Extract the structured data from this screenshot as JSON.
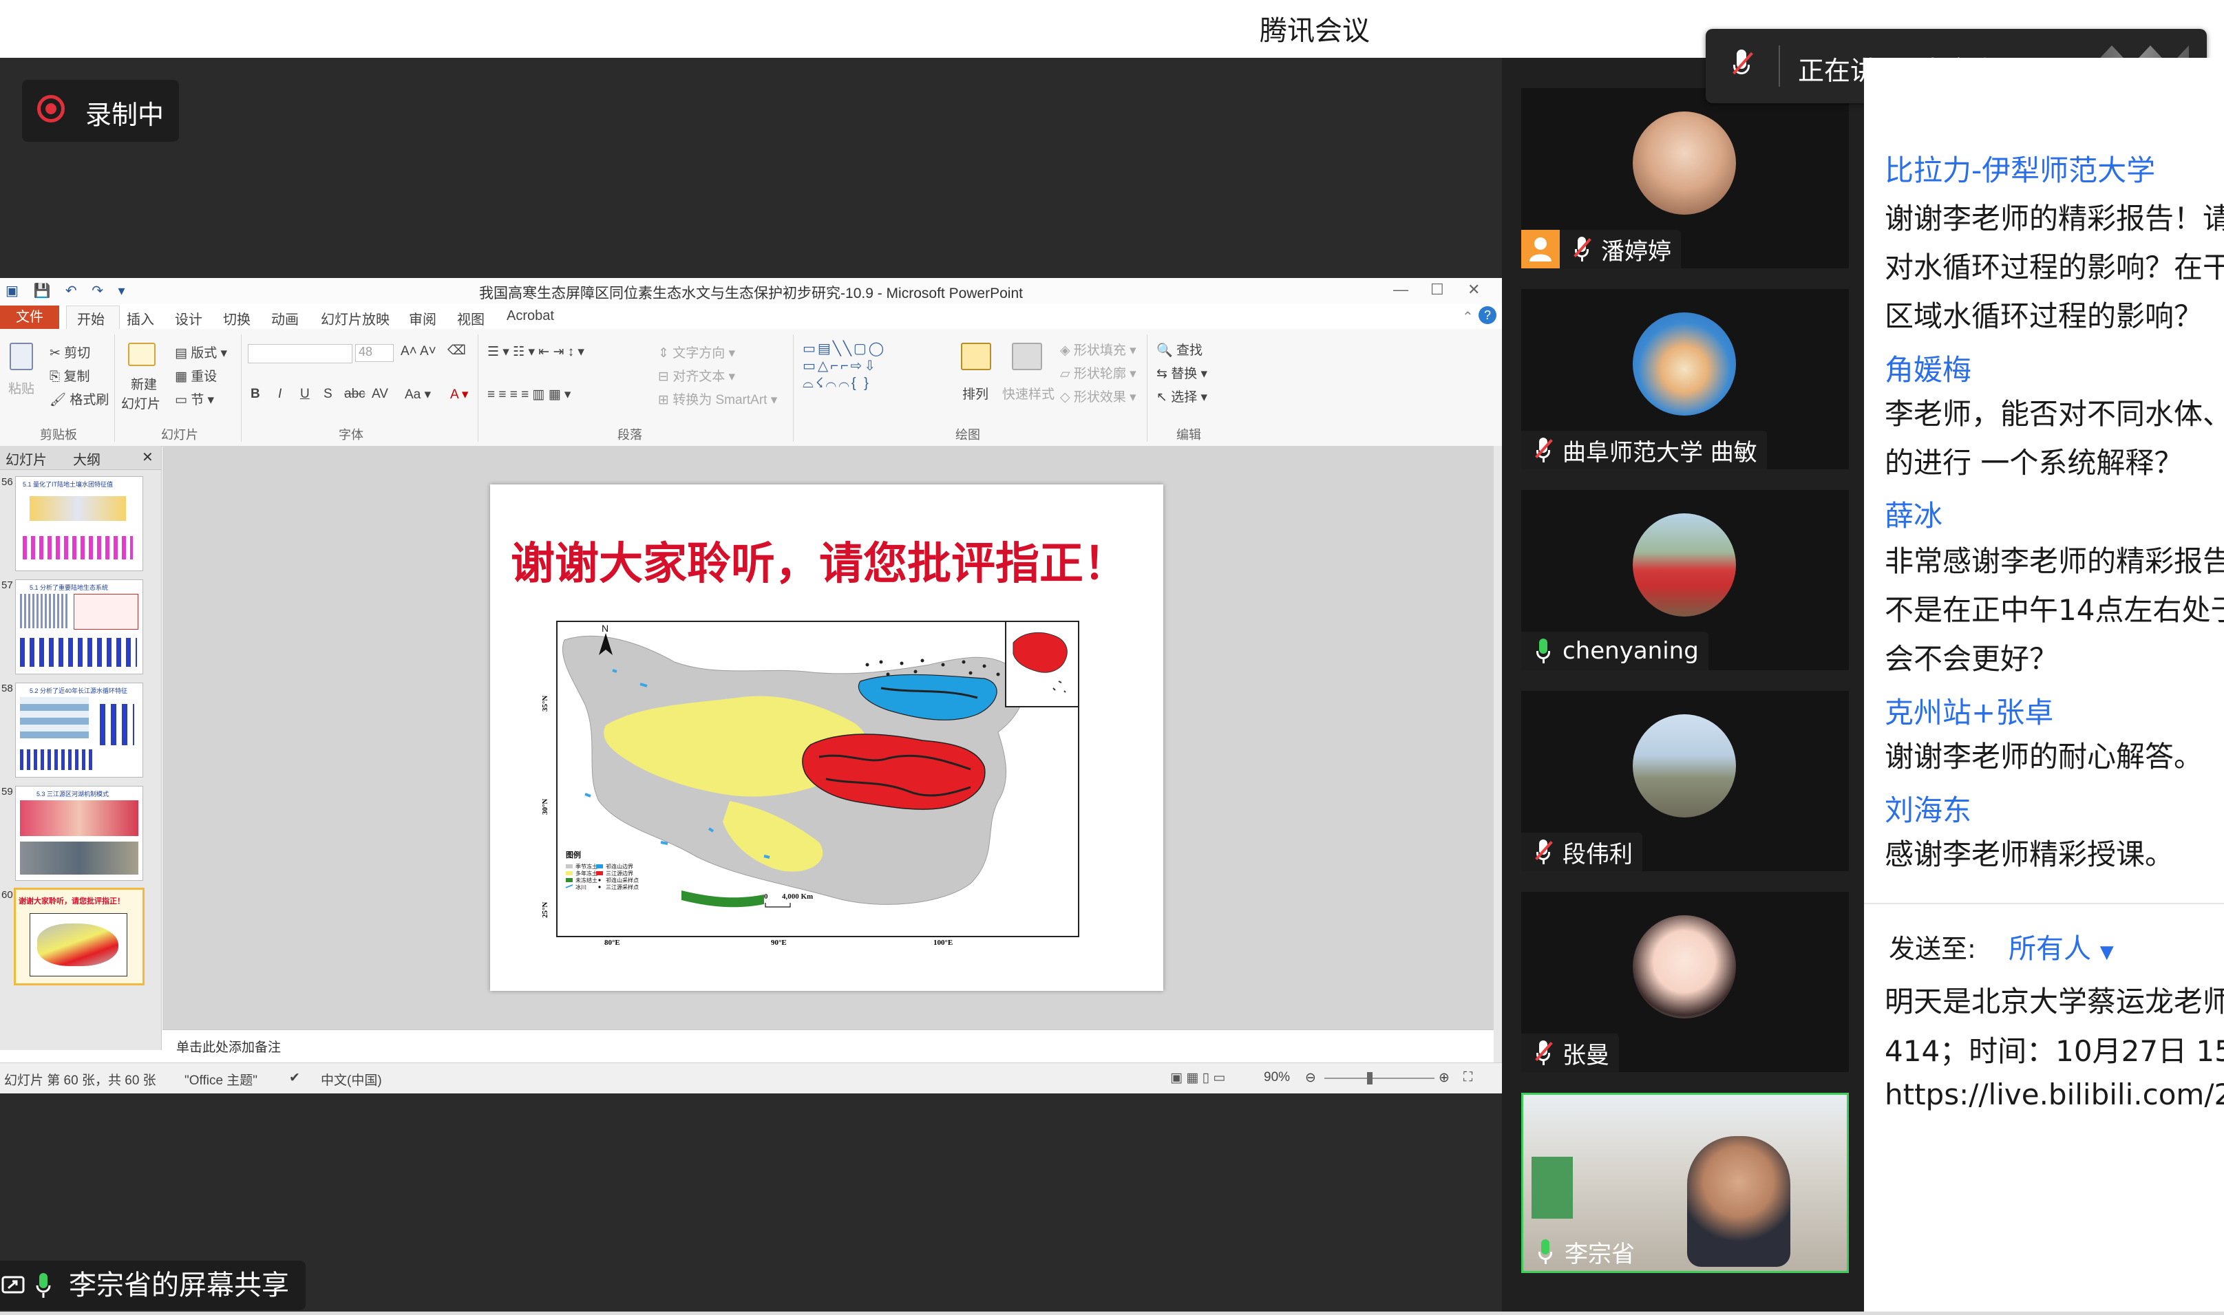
{
  "app": {
    "title": "腾讯会议"
  },
  "recording": {
    "label": "录制中"
  },
  "share": {
    "label": "李宗省的屏幕共享"
  },
  "speaking": {
    "label": "正在讲话: 李宗省;"
  },
  "ppt": {
    "window_title": "我国高寒生态屏障区同位素生态水文与生态保护初步研究-10.9 - Microsoft PowerPoint",
    "tabs": [
      "文件",
      "开始",
      "插入",
      "设计",
      "切换",
      "动画",
      "幻灯片放映",
      "审阅",
      "视图",
      "Acrobat"
    ],
    "ribbon": {
      "clipboard": {
        "paste": "粘贴",
        "cut": "剪切",
        "copy": "复制",
        "format_painter": "格式刷",
        "group": "剪贴板"
      },
      "slides": {
        "new_slide": "新建",
        "new_slide2": "幻灯片",
        "layout": "版式",
        "reset": "重设",
        "section": "节",
        "group": "幻灯片"
      },
      "font": {
        "size": "48",
        "group": "字体"
      },
      "paragraph": {
        "text_direction": "文字方向",
        "align_text": "对齐文本",
        "smartart": "转换为 SmartArt",
        "group": "段落"
      },
      "drawing": {
        "arrange": "排列",
        "quick_styles": "快速样式",
        "fill": "形状填充",
        "outline": "形状轮廓",
        "effects": "形状效果",
        "group": "绘图"
      },
      "editing": {
        "find": "查找",
        "replace": "替换",
        "select": "选择",
        "group": "编辑"
      }
    },
    "left_tabs": [
      "幻灯片",
      "大纲"
    ],
    "thumbnails": [
      {
        "num": "56",
        "title": "5.1 量化了IT陆地土壤水团特征值"
      },
      {
        "num": "57",
        "title": "5.1 分析了重要陆地生态系统"
      },
      {
        "num": "58",
        "title": "5.2 分析了近40年长江源水循环特征"
      },
      {
        "num": "59",
        "title": "5.3 三江源区河湖机制模式"
      },
      {
        "num": "60",
        "title": "谢谢大家聆听，请您批评指正！"
      }
    ],
    "slide": {
      "title": "谢谢大家聆听，请您批评指正！",
      "north": "N",
      "lat_labels": [
        "35°N",
        "30°N",
        "25°N"
      ],
      "lon_labels": [
        "80°E",
        "90°E",
        "100°E"
      ],
      "scale": [
        "0",
        "4,000 Km"
      ],
      "legend_title": "图例",
      "legend": [
        "季节冻土",
        "多年冻土",
        "未冻结土",
        "冰川",
        "祁连山边界",
        "三江源边界",
        "祁连山采样点",
        "三江源采样点"
      ]
    },
    "notes_placeholder": "单击此处添加备注",
    "status": {
      "slide_count": "幻灯片 第 60 张，共 60 张",
      "theme": "\"Office 主题\"",
      "language": "中文(中国)",
      "zoom": "90%"
    }
  },
  "participants": [
    {
      "name": "潘婷婷",
      "mic": "muted",
      "host": true
    },
    {
      "name": "曲阜师范大学 曲敏",
      "mic": "muted",
      "host": false
    },
    {
      "name": "chenyaning",
      "mic": "on",
      "host": false
    },
    {
      "name": "段伟利",
      "mic": "muted",
      "host": false
    },
    {
      "name": "张曼",
      "mic": "muted",
      "host": false
    },
    {
      "name": "李宗省",
      "mic": "on",
      "host": false
    }
  ],
  "chat": {
    "messages": [
      {
        "name": "比拉力-伊犁师范大学",
        "lines": [
          "谢谢李老师的精彩报告！请",
          "对水循环过程的影响？在干",
          "区域水循环过程的影响？"
        ]
      },
      {
        "name": "角媛梅",
        "lines": [
          "李老师，能否对不同水体、",
          "的进行 一个系统解释？"
        ]
      },
      {
        "name": "薛冰",
        "lines": [
          "非常感谢李老师的精彩报告",
          "不是在正中午14点左右处于",
          "会不会更好？"
        ]
      },
      {
        "name": "克州站+张卓",
        "lines": [
          "谢谢李老师的耐心解答。"
        ]
      },
      {
        "name": "刘海东",
        "lines": [
          "感谢李老师精彩授课。"
        ]
      }
    ],
    "send_to_label": "发送至:",
    "send_to_value": "所有人",
    "draft_lines": [
      "明天是北京大学蔡运龙老师",
      "414；时间：10月27日 15",
      "https://live.bilibili.com/2"
    ]
  },
  "colors": {
    "accent": "#2a6fe8",
    "record": "#e0313b",
    "slide_title": "#d6102a",
    "ppt_file_tab": "#d24726"
  }
}
